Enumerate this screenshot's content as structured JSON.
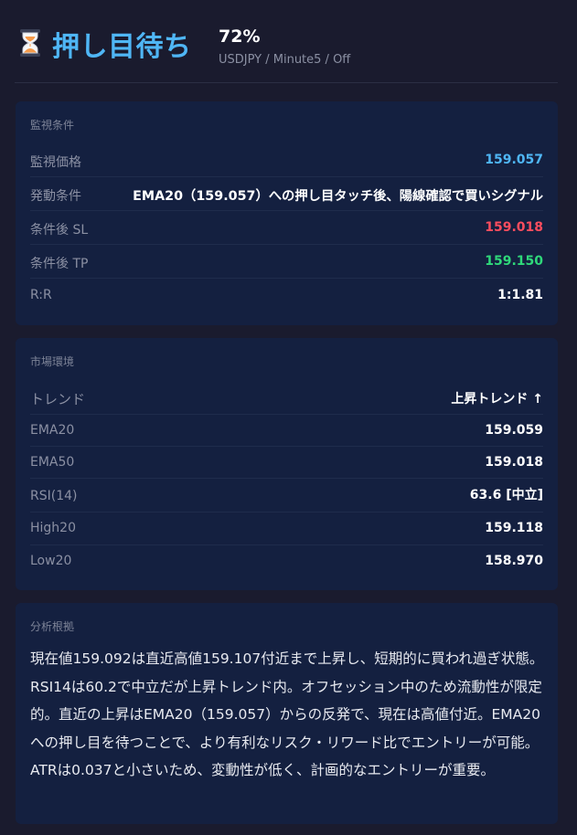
{
  "header": {
    "title": "押し目待ち",
    "confidence": "72%",
    "subinfo": "USDJPY / Minute5 / Off",
    "icon": "hourglass-icon"
  },
  "monitor": {
    "section_title": "監視条件",
    "rows": [
      {
        "label": "監視価格",
        "value": "159.057",
        "color": "#4fb6f5"
      },
      {
        "label": "発動条件",
        "value": "EMA20（159.057）への押し目タッチ後、陽線確認で買いシグナル",
        "color": "#ffffff"
      },
      {
        "label": "条件後 SL",
        "value": "159.018",
        "color": "#ff4d5e"
      },
      {
        "label": "条件後 TP",
        "value": "159.150",
        "color": "#2fd87a"
      },
      {
        "label": "R:R",
        "value": "1:1.81",
        "color": "#ffffff"
      }
    ]
  },
  "market": {
    "section_title": "市場環境",
    "rows": [
      {
        "label": "トレンド",
        "value": "上昇トレンド ↑"
      },
      {
        "label": "EMA20",
        "value": "159.059"
      },
      {
        "label": "EMA50",
        "value": "159.018"
      },
      {
        "label": "RSI(14)",
        "value": "63.6 [中立]"
      },
      {
        "label": "High20",
        "value": "159.118"
      },
      {
        "label": "Low20",
        "value": "158.970"
      }
    ]
  },
  "analysis": {
    "section_title": "分析根拠",
    "text": "現在値159.092は直近高値159.107付近まで上昇し、短期的に買われ過ぎ状態。RSI14は60.2で中立だが上昇トレンド内。オフセッション中のため流動性が限定的。直近の上昇はEMA20（159.057）からの反発で、現在は高値付近。EMA20への押し目を待つことで、より有利なリスク・リワード比でエントリーが可能。ATRは0.037と小さいため、変動性が低く、計画的なエントリーが重要。"
  }
}
